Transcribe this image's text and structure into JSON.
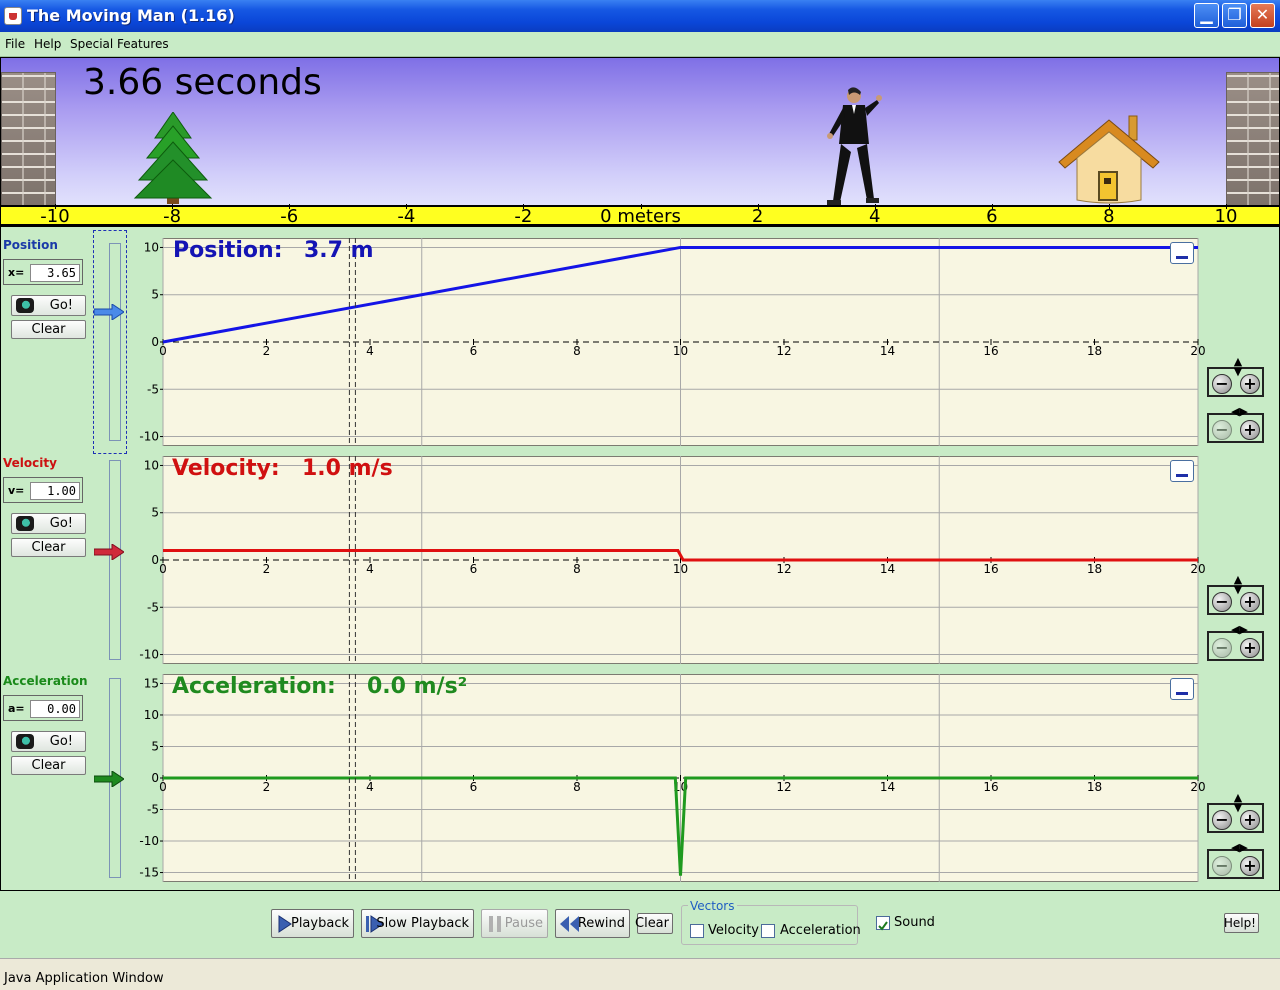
{
  "window": {
    "title": "The Moving Man (1.16)",
    "minimize": "▁",
    "maximize": "❐",
    "close": "✕"
  },
  "menu": [
    "File",
    "Help",
    "Special Features"
  ],
  "scene": {
    "time_label": "3.66 seconds",
    "ruler_ticks": [
      "-10",
      "-8",
      "-6",
      "-4",
      "-2",
      "0 meters",
      "2",
      "4",
      "6",
      "8",
      "10"
    ]
  },
  "position": {
    "section_label": "Position",
    "var_label": "x=",
    "value": "3.65",
    "go_label": "Go!",
    "clear_label": "Clear",
    "readout_name": "Position:",
    "readout_value": "3.7 m",
    "color": "#1414e6"
  },
  "velocity": {
    "section_label": "Velocity",
    "var_label": "v=",
    "value": "1.00",
    "go_label": "Go!",
    "clear_label": "Clear",
    "readout_name": "Velocity:",
    "readout_value": "1.0 m/s",
    "color": "#e01010"
  },
  "acceleration": {
    "section_label": "Acceleration",
    "var_label": "a=",
    "value": "0.00",
    "go_label": "Go!",
    "clear_label": "Clear",
    "readout_name": "Acceleration:",
    "readout_value": "0.0 m/s²",
    "color": "#1f9a1f"
  },
  "chart_data": [
    {
      "type": "line",
      "name": "position",
      "x": [
        0,
        10,
        20
      ],
      "y": [
        0,
        10,
        10
      ],
      "xlim": [
        0,
        20
      ],
      "ylim": [
        -11,
        11
      ],
      "yticks": [
        -10,
        -5,
        0,
        5,
        10
      ],
      "xticks": [
        0,
        2,
        4,
        6,
        8,
        10,
        12,
        14,
        16,
        18,
        20
      ],
      "cursor_x": 3.66,
      "grid": true
    },
    {
      "type": "line",
      "name": "velocity",
      "x": [
        0,
        9.95,
        10.05,
        20
      ],
      "y": [
        1,
        1,
        0,
        0
      ],
      "xlim": [
        0,
        20
      ],
      "ylim": [
        -11,
        11
      ],
      "yticks": [
        -10,
        -5,
        0,
        5,
        10
      ],
      "xticks": [
        0,
        2,
        4,
        6,
        8,
        10,
        12,
        14,
        16,
        18,
        20
      ],
      "cursor_x": 3.66,
      "grid": true
    },
    {
      "type": "line",
      "name": "acceleration",
      "x": [
        0,
        9.9,
        10,
        10.1,
        20
      ],
      "y": [
        0,
        0,
        -15.5,
        0,
        0
      ],
      "xlim": [
        0,
        20
      ],
      "ylim": [
        -16.5,
        16.5
      ],
      "yticks": [
        -15,
        -10,
        -5,
        0,
        5,
        10,
        15
      ],
      "xticks": [
        0,
        2,
        4,
        6,
        8,
        10,
        12,
        14,
        16,
        18,
        20
      ],
      "cursor_x": 3.66,
      "grid": true
    }
  ],
  "playback": {
    "playback": "Playback",
    "slow_playback": "Slow Playback",
    "pause": "Pause",
    "rewind": "Rewind",
    "clear": "Clear",
    "vectors_legend": "Vectors",
    "velocity_check": "Velocity",
    "acceleration_check": "Acceleration",
    "sound_check": "Sound",
    "help": "Help!"
  },
  "status": "Java Application Window"
}
